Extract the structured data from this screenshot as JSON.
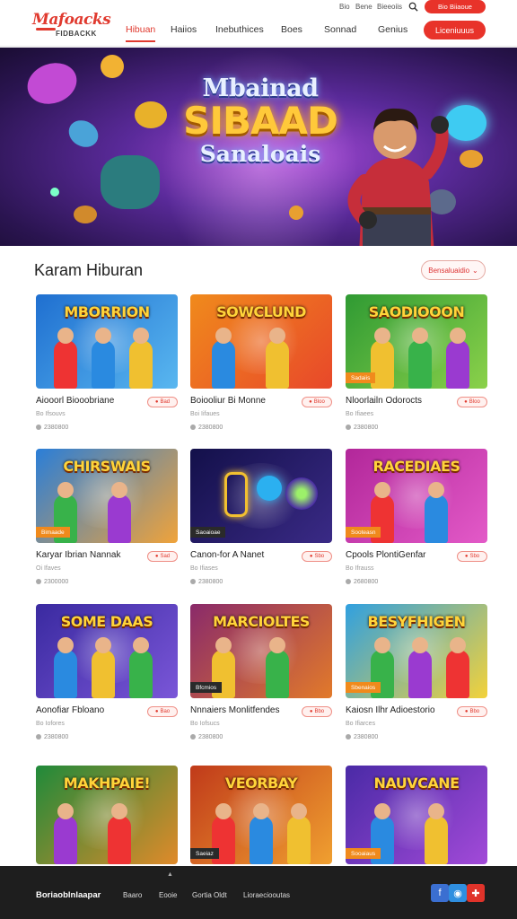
{
  "brand": {
    "logo_top": "Mafoacks",
    "logo_bottom": "FIDBACKK",
    "accent": "#e8332a"
  },
  "top_bar": {
    "links": [
      "Bio",
      "Bene",
      "Bieeoiis"
    ],
    "pill_label": "Bio Biiaoue"
  },
  "nav": {
    "items": [
      "Hibuan",
      "Haiios",
      "Inebuthices",
      "Boes",
      "Sonnad",
      "Genius"
    ],
    "active_index": 0,
    "cta_label": "Liceniuuus"
  },
  "hero": {
    "line1": "Mbainad",
    "line2": "SIBAAD",
    "line3": "Sanaloais"
  },
  "section": {
    "title": "Karam Hiburan",
    "button_label": "Bensaluaidio"
  },
  "games": [
    {
      "name": "Aiooorl Biooobriane",
      "sub": "Bo Ifsouvs",
      "badge": "Bad",
      "players": "2380800",
      "thumb_title": "MBORRION",
      "tag": ""
    },
    {
      "name": "Boiooliur Bi Monne",
      "sub": "Boi Iifaues",
      "badge": "Bloo",
      "players": "2380800",
      "thumb_title": "SOWCLUND",
      "tag": ""
    },
    {
      "name": "Nloorlailn Odorocts",
      "sub": "Bo Ifiaees",
      "badge": "Bloo",
      "players": "2380800",
      "thumb_title": "SAODIOOON",
      "tag": "Sadaiis"
    },
    {
      "name": "Karyar Ibrian Nannak",
      "sub": "Oi Ifaves",
      "badge": "Sad",
      "players": "2300000",
      "thumb_title": "CHIRSWAIS",
      "tag": "Bimaade"
    },
    {
      "name": "Canon-for A Nanet",
      "sub": "Bo Ifiases",
      "badge": "Sbo",
      "players": "2380800",
      "thumb_title": "",
      "tag": "Saoaioae"
    },
    {
      "name": "Cpools PlontiGenfar",
      "sub": "Bo Ifrauss",
      "badge": "Sbo",
      "players": "2680800",
      "thumb_title": "RACEDIAES",
      "tag": "Sooteasn"
    },
    {
      "name": "Aonofiar Fbloano",
      "sub": "Bo Iofores",
      "badge": "Bao",
      "players": "2380800",
      "thumb_title": "SOME DAAS",
      "tag": ""
    },
    {
      "name": "Nnnaiers Monlitfendes",
      "sub": "Bo Iofsucs",
      "badge": "Bbo",
      "players": "2380800",
      "thumb_title": "MARCIOLTES",
      "tag": "Bfcmios"
    },
    {
      "name": "Kaiosn Ilhr Adioestorio",
      "sub": "Bo Ifiarces",
      "badge": "Bbo",
      "players": "2380800",
      "thumb_title": "BESYFHIGEN",
      "tag": "Sbenaios"
    },
    {
      "name": "",
      "sub": "",
      "badge": "",
      "players": "",
      "thumb_title": "MAKHPAIE!",
      "tag": ""
    },
    {
      "name": "",
      "sub": "",
      "badge": "",
      "players": "",
      "thumb_title": "VEORBAY",
      "tag": "Saeiaz"
    },
    {
      "name": "",
      "sub": "",
      "badge": "",
      "players": "",
      "thumb_title": "NAUVCANE",
      "tag": "Sooaiaus"
    }
  ],
  "footer": {
    "brand": "Boriaoblnlaapar",
    "links": [
      "Baaro",
      "Eooie",
      "Gortia Oldt",
      "Lioraeciooutas"
    ],
    "up_arrow": "▲",
    "social": [
      "f",
      "◉",
      "✚"
    ]
  }
}
